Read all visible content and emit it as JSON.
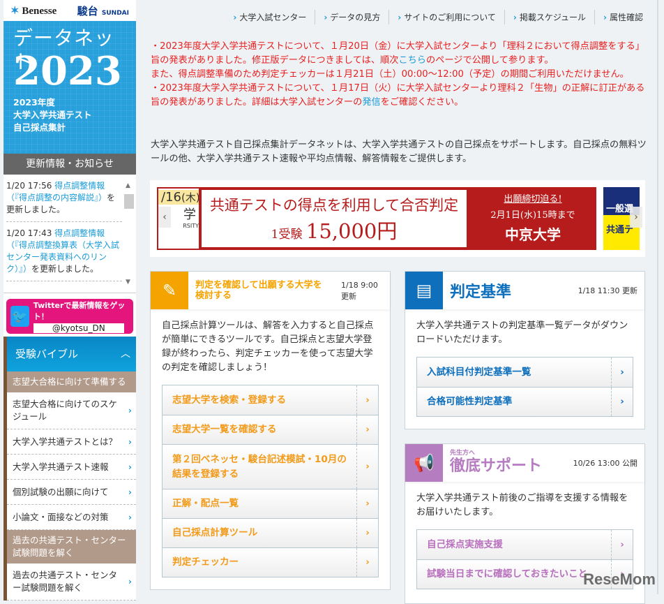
{
  "logos": {
    "benesse": "Benesse",
    "sundai": "駿台",
    "sundai_en": "SUNDAI"
  },
  "hero": {
    "title": "データネット",
    "year": "2023",
    "line1": "2023年度",
    "line2": "大学入学共通テスト",
    "line3": "自己採点集計"
  },
  "news": {
    "heading": "更新情報・お知らせ",
    "items": [
      {
        "time": "1/20 17:56",
        "link": "得点調整情報（『得点調整の内容解説』）",
        "rest": "を更新しました。"
      },
      {
        "time": "1/20 17:43",
        "link": "得点調整情報（『得点調整換算表（大学入試センター発表資料へのリンク）』）",
        "rest": "を更新しました。"
      }
    ]
  },
  "twitter": {
    "text": "Twitterで最新情報をゲット！",
    "handle": "@kyotsu_DN"
  },
  "bible": {
    "title": "受験バイブル",
    "cat1": "志望大合格に向けて準備する",
    "items1": [
      "志望大合格に向けてのスケジュール",
      "大学入学共通テストとは？",
      "大学入学共通テスト速報",
      "個別試験の出願に向けて",
      "小論文・面接などの対策"
    ],
    "cat2": "過去の共通テスト・センター試験問題を解く",
    "items2": [
      "過去の共通テスト・センター試験問題を解く"
    ]
  },
  "topnav": [
    "大学入試センター",
    "データの見方",
    "サイトのご利用について",
    "掲載スケジュール",
    "属性確認"
  ],
  "notice": {
    "p1a": "・2023年度大学入学共通テストについて、１月20日（金）に大学入試センターより「理科２において得点調整をする」旨の発表がありました。修正版データにつきましては、順次",
    "p1link": "こちら",
    "p1b": "のページで公開して参ります。",
    "p2": "また、得点調整準備のため判定チェッカーは１月21日（土）00:00～12:00（予定）の期間ご利用いただけません。",
    "p3a": "・2023年度大学入学共通テストについて、１月17日（火）に大学入試センターより理科２「生物」の正解に訂正がある旨の発表がありました。詳細は大学入試センターの",
    "p3link": "発信",
    "p3b": "をご確認ください。"
  },
  "intro": "大学入学共通テスト自己採点集計データネットは、大学入学共通テストの自己採点をサポートします。自己採点の無料ツールの他、大学入学共通テスト速報や平均点情報、解答情報をご提供します。",
  "banner": {
    "prev_date": "/16",
    "prev_day": "(木)",
    "prev_text": "学",
    "prev_sub": "RSITY",
    "main_a": "共通テストの得点を利用して合否判定",
    "main_b1": "1受験",
    "main_b2": "15,000円",
    "deadline": "出願締切迫る!",
    "date": "2月1日(水)15時まで",
    "univ": "中京大学",
    "next_a": "一般選",
    "next_b": "共通テ"
  },
  "card1": {
    "title": "判定を確認して出願する大学を検討する",
    "date": "1/18 9:00 更新",
    "desc": "自己採点計算ツールは、解答を入力すると自己採点が簡単にできるツールです。自己採点と志望大学登録が終わったら、判定チェッカーを使って志望大学の判定を確認しましょう！",
    "links": [
      "志望大学を検索・登録する",
      "志望大学一覧を確認する",
      "第２回ベネッセ・駿台記述模試・10月の結果を登録する",
      "正解・配点一覧",
      "自己採点計算ツール",
      "判定チェッカー"
    ]
  },
  "card2": {
    "title": "判定基準",
    "date": "1/18 11:30 更新",
    "desc": "大学入学共通テストの判定基準一覧データがダウンロードいただけます。",
    "links": [
      "入試科目付判定基準一覧",
      "合格可能性判定基準"
    ]
  },
  "card3": {
    "sub": "先生方へ",
    "title": "徹底サポート",
    "date": "10/26 13:00 公開",
    "desc": "大学入学共通テスト前後のご指導を支援する情報をお届けいたします。",
    "links": [
      "自己採点実施支援",
      "試験当日までに確認しておきたいこと"
    ]
  },
  "watermark": "ReseMom",
  "colors": {
    "orange": "#f5a300",
    "blue": "#0e6fbd",
    "purple": "#b57cc0",
    "red": "#e82020"
  }
}
